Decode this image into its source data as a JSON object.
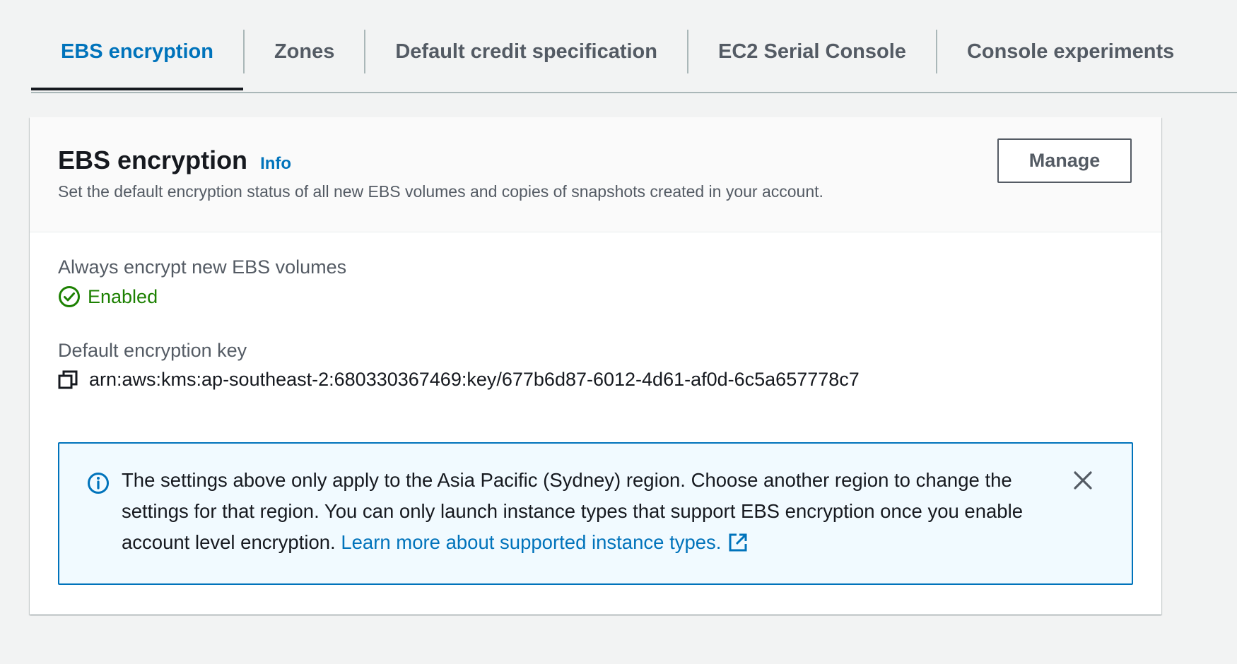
{
  "tabs": [
    {
      "label": "EBS encryption",
      "active": true
    },
    {
      "label": "Zones",
      "active": false
    },
    {
      "label": "Default credit specification",
      "active": false
    },
    {
      "label": "EC2 Serial Console",
      "active": false
    },
    {
      "label": "Console experiments",
      "active": false
    }
  ],
  "card": {
    "title": "EBS encryption",
    "info_label": "Info",
    "description": "Set the default encryption status of all new EBS volumes and copies of snapshots created in your account.",
    "manage_label": "Manage"
  },
  "fields": {
    "always_encrypt": {
      "label": "Always encrypt new EBS volumes",
      "value": "Enabled",
      "icon": "check-circle-icon"
    },
    "default_key": {
      "label": "Default encryption key",
      "value": "arn:aws:kms:ap-southeast-2:680330367469:key/677b6d87-6012-4d61-af0d-6c5a657778c7",
      "icon": "copy-icon"
    }
  },
  "alert": {
    "text": "The settings above only apply to the Asia Pacific (Sydney) region. Choose another region to change the settings for that region. You can only launch instance types that support EBS encryption once you enable account level encryption. ",
    "link_text": "Learn more about supported instance types.",
    "icon": "info-icon"
  },
  "colors": {
    "accent": "#0073bb",
    "success": "#1d8102",
    "text": "#16191f",
    "muted": "#545b64",
    "alert_bg": "#f1faff",
    "page_bg": "#f2f3f3"
  }
}
